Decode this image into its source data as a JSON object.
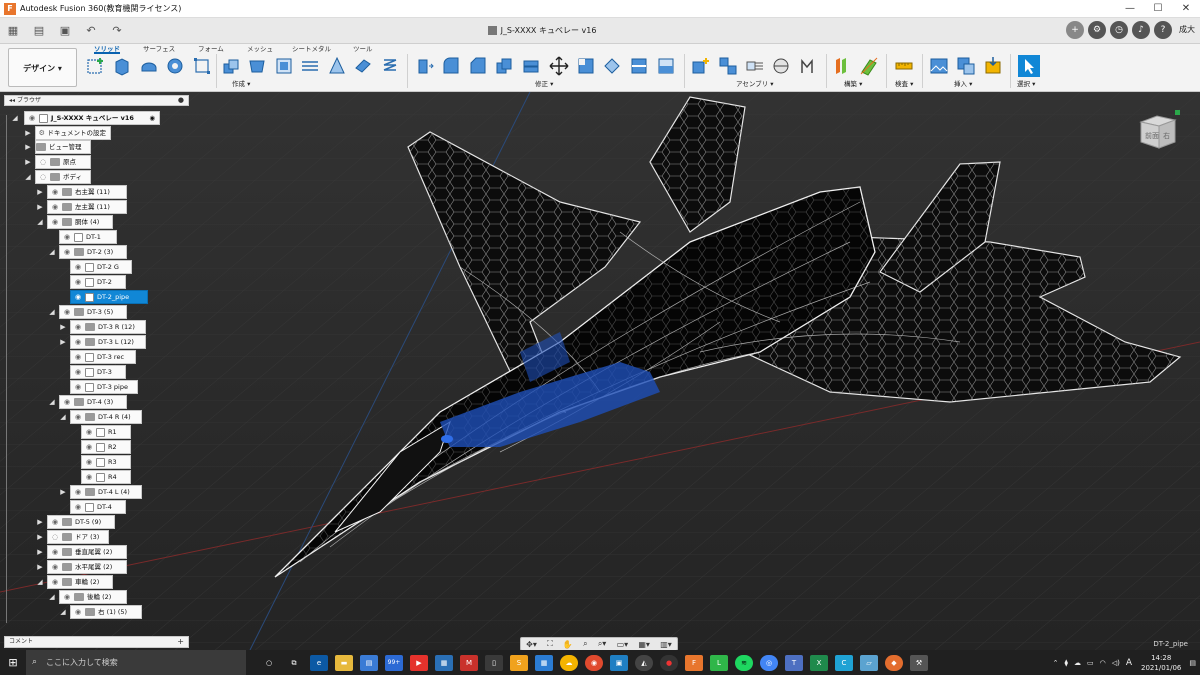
{
  "window": {
    "title": "Autodesk Fusion 360(教育機関ライセンス)",
    "minimize": "—",
    "maximize": "☐",
    "close": "✕"
  },
  "document_tab": {
    "title": "J_S-XXXX キュベレー v16",
    "close": "✕"
  },
  "user_badge": "成大",
  "design_button": {
    "label": "デザイン ▾"
  },
  "toolbar_tabs": [
    "ソリッド",
    "サーフェス",
    "フォーム",
    "メッシュ",
    "シートメタル",
    "ツール"
  ],
  "toolbar_groups": {
    "create": "作成 ▾",
    "modify": "修正 ▾",
    "assemble": "アセンブリ ▾",
    "construct": "構築 ▾",
    "inspect": "検査 ▾",
    "insert": "挿入 ▾",
    "select": "選択 ▾"
  },
  "browser": {
    "title": "ブラウザ",
    "root": "J_S-XXXX キュベレー v16",
    "items": [
      {
        "label": "ドキュメントの設定"
      },
      {
        "label": "ビュー管理"
      },
      {
        "label": "原点"
      },
      {
        "label": "ボディ"
      },
      {
        "label": "右主翼 (11)"
      },
      {
        "label": "左主翼 (11)"
      },
      {
        "label": "胴体 (4)"
      },
      {
        "label": "DT-1"
      },
      {
        "label": "DT-2 (3)"
      },
      {
        "label": "DT-2 G"
      },
      {
        "label": "DT-2"
      },
      {
        "label": "DT-2_pipe"
      },
      {
        "label": "DT-3 (5)"
      },
      {
        "label": "DT-3 R (12)"
      },
      {
        "label": "DT-3 L (12)"
      },
      {
        "label": "DT-3 rec"
      },
      {
        "label": "DT-3"
      },
      {
        "label": "DT-3 pipe"
      },
      {
        "label": "DT-4 (3)"
      },
      {
        "label": "DT-4 R (4)"
      },
      {
        "label": "R1"
      },
      {
        "label": "R2"
      },
      {
        "label": "R3"
      },
      {
        "label": "R4"
      },
      {
        "label": "DT-4 L (4)"
      },
      {
        "label": "DT-4"
      },
      {
        "label": "DT-5 (9)"
      },
      {
        "label": "ドア (3)"
      },
      {
        "label": "垂直尾翼 (2)"
      },
      {
        "label": "水平尾翼 (2)"
      },
      {
        "label": "車輪 (2)"
      },
      {
        "label": "後輪 (2)"
      },
      {
        "label": "右 (1) (5)"
      }
    ]
  },
  "comments_panel": {
    "title": "コメント",
    "add": "+"
  },
  "status_text": "DT-2_pipe",
  "viewcube": {
    "front": "前面",
    "right": "右"
  },
  "taskbar": {
    "search_placeholder": "ここに入力して検索",
    "mail_badge": "99+",
    "time": "14:28",
    "date": "2021/01/06",
    "ime": "A"
  },
  "colors": {
    "selection": "#1187d6",
    "accent_blue": "#0a62b0",
    "model_highlight": "#1e4fb8"
  }
}
